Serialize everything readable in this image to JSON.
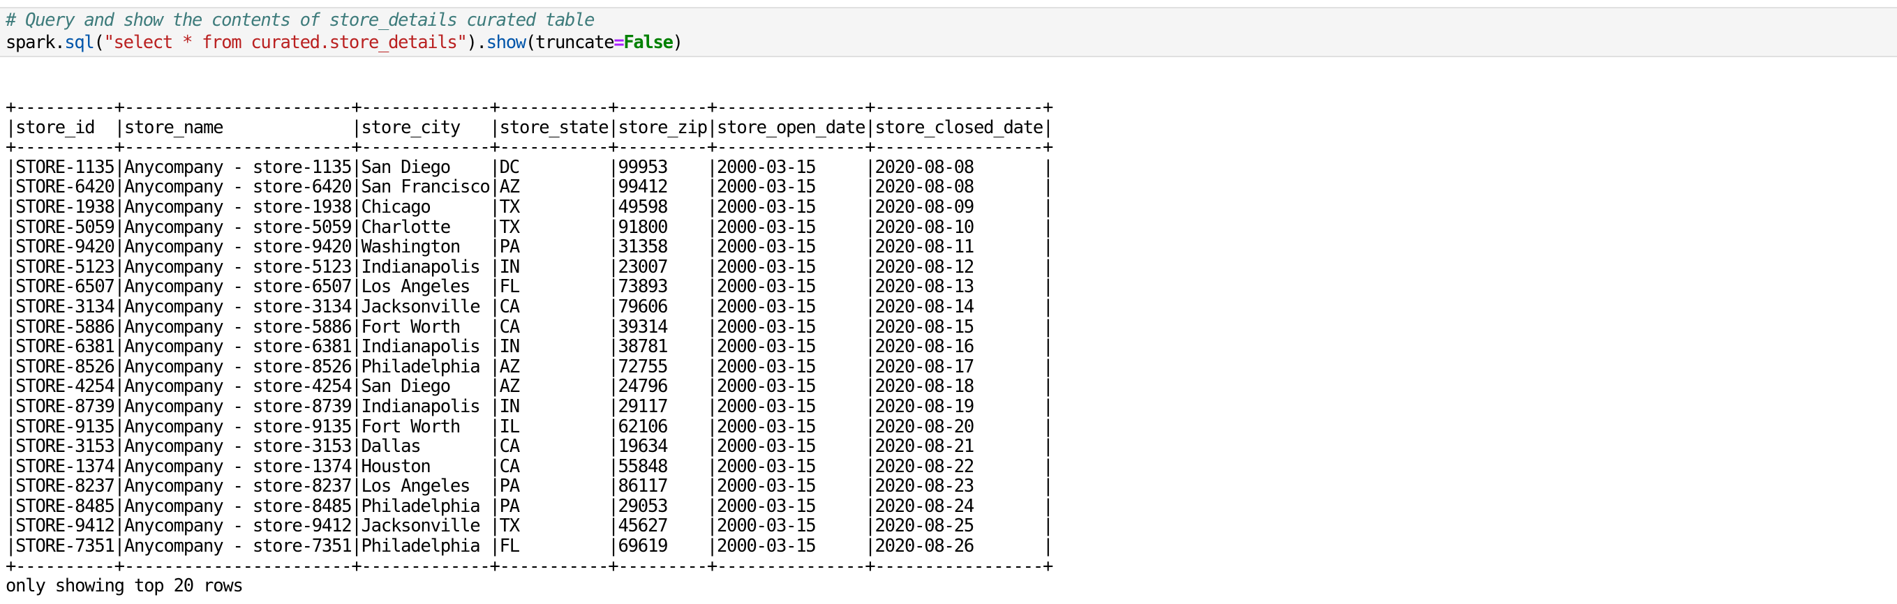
{
  "code_cell": {
    "comment": "# Query and show the contents of store_details curated table",
    "code_tokens": [
      {
        "text": "spark.",
        "cls": ""
      },
      {
        "text": "sql",
        "cls": "fn"
      },
      {
        "text": "(",
        "cls": ""
      },
      {
        "text": "\"select * from curated.store_details\"",
        "cls": "st"
      },
      {
        "text": ").",
        "cls": ""
      },
      {
        "text": "show",
        "cls": "fn"
      },
      {
        "text": "(truncate",
        "cls": ""
      },
      {
        "text": "=",
        "cls": "op"
      },
      {
        "text": "False",
        "cls": "kw"
      },
      {
        "text": ")",
        "cls": ""
      }
    ]
  },
  "output": {
    "columns": [
      "store_id",
      "store_name",
      "store_city",
      "store_state",
      "store_zip",
      "store_open_date",
      "store_closed_date"
    ],
    "rows": [
      [
        "STORE-1135",
        "Anycompany - store-1135",
        "San Diego",
        "DC",
        "99953",
        "2000-03-15",
        "2020-08-08"
      ],
      [
        "STORE-6420",
        "Anycompany - store-6420",
        "San Francisco",
        "AZ",
        "99412",
        "2000-03-15",
        "2020-08-08"
      ],
      [
        "STORE-1938",
        "Anycompany - store-1938",
        "Chicago",
        "TX",
        "49598",
        "2000-03-15",
        "2020-08-09"
      ],
      [
        "STORE-5059",
        "Anycompany - store-5059",
        "Charlotte",
        "TX",
        "91800",
        "2000-03-15",
        "2020-08-10"
      ],
      [
        "STORE-9420",
        "Anycompany - store-9420",
        "Washington",
        "PA",
        "31358",
        "2000-03-15",
        "2020-08-11"
      ],
      [
        "STORE-5123",
        "Anycompany - store-5123",
        "Indianapolis",
        "IN",
        "23007",
        "2000-03-15",
        "2020-08-12"
      ],
      [
        "STORE-6507",
        "Anycompany - store-6507",
        "Los Angeles",
        "FL",
        "73893",
        "2000-03-15",
        "2020-08-13"
      ],
      [
        "STORE-3134",
        "Anycompany - store-3134",
        "Jacksonville",
        "CA",
        "79606",
        "2000-03-15",
        "2020-08-14"
      ],
      [
        "STORE-5886",
        "Anycompany - store-5886",
        "Fort Worth",
        "CA",
        "39314",
        "2000-03-15",
        "2020-08-15"
      ],
      [
        "STORE-6381",
        "Anycompany - store-6381",
        "Indianapolis",
        "IN",
        "38781",
        "2000-03-15",
        "2020-08-16"
      ],
      [
        "STORE-8526",
        "Anycompany - store-8526",
        "Philadelphia",
        "AZ",
        "72755",
        "2000-03-15",
        "2020-08-17"
      ],
      [
        "STORE-4254",
        "Anycompany - store-4254",
        "San Diego",
        "AZ",
        "24796",
        "2000-03-15",
        "2020-08-18"
      ],
      [
        "STORE-8739",
        "Anycompany - store-8739",
        "Indianapolis",
        "IN",
        "29117",
        "2000-03-15",
        "2020-08-19"
      ],
      [
        "STORE-9135",
        "Anycompany - store-9135",
        "Fort Worth",
        "IL",
        "62106",
        "2000-03-15",
        "2020-08-20"
      ],
      [
        "STORE-3153",
        "Anycompany - store-3153",
        "Dallas",
        "CA",
        "19634",
        "2000-03-15",
        "2020-08-21"
      ],
      [
        "STORE-1374",
        "Anycompany - store-1374",
        "Houston",
        "CA",
        "55848",
        "2000-03-15",
        "2020-08-22"
      ],
      [
        "STORE-8237",
        "Anycompany - store-8237",
        "Los Angeles",
        "PA",
        "86117",
        "2000-03-15",
        "2020-08-23"
      ],
      [
        "STORE-8485",
        "Anycompany - store-8485",
        "Philadelphia",
        "PA",
        "29053",
        "2000-03-15",
        "2020-08-24"
      ],
      [
        "STORE-9412",
        "Anycompany - store-9412",
        "Jacksonville",
        "TX",
        "45627",
        "2000-03-15",
        "2020-08-25"
      ],
      [
        "STORE-7351",
        "Anycompany - store-7351",
        "Philadelphia",
        "FL",
        "69619",
        "2000-03-15",
        "2020-08-26"
      ]
    ],
    "footer": "only showing top 20 rows"
  }
}
